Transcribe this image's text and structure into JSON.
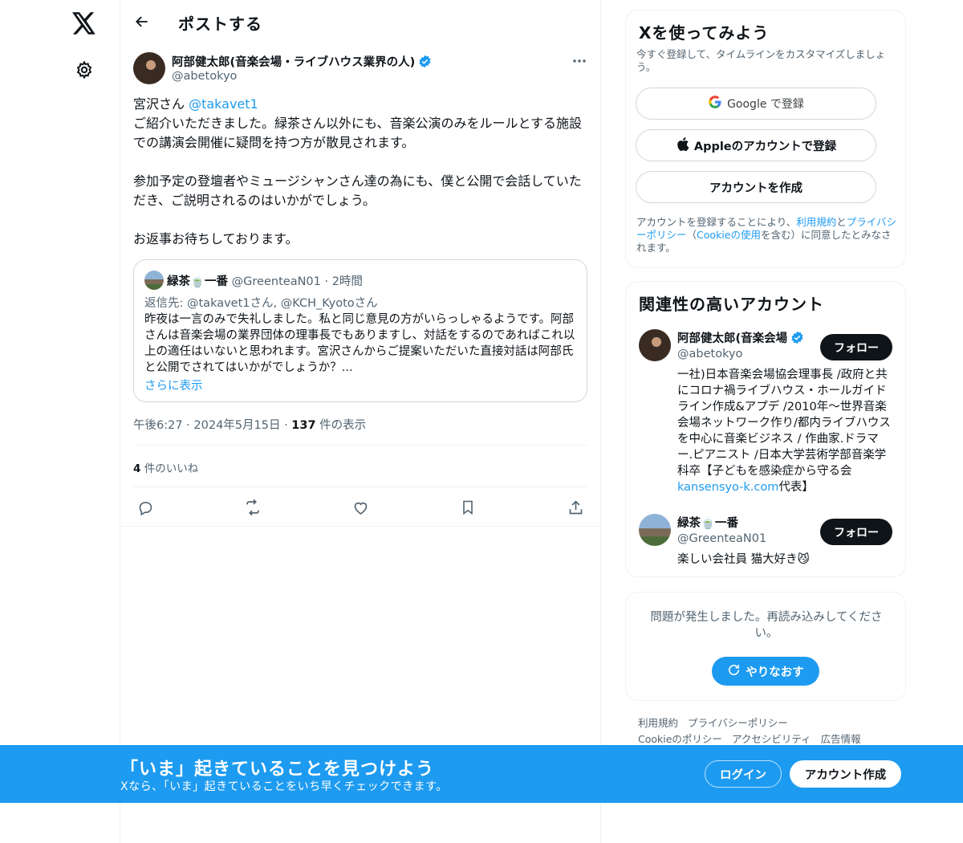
{
  "nav": {
    "logo": "X",
    "settings_icon": "gear-icon"
  },
  "header": {
    "back_icon": "arrow-left-icon",
    "title": "ポストする"
  },
  "tweet": {
    "author_name": "阿部健太郎(音楽会場・ライブハウス業界の人)",
    "author_handle": "@abetokyo",
    "greeting": "宮沢さん ",
    "mention": "@takavet1",
    "body": "\nご紹介いただきました。緑茶さん以外にも、音楽公演のみをルールとする施設での講演会開催に疑問を持つ方が散見されます。\n\n参加予定の登壇者やミュージシャンさん達の為にも、僕と公開で会話していただき、ご説明されるのはいかがでしょう。\n\nお返事お待ちしております。",
    "time": "午後6:27 · 2024年5月15日 · ",
    "views_count": "137",
    "views_label": " 件の表示",
    "likes_count": "4",
    "likes_label": " 件のいいね"
  },
  "quote": {
    "name": "緑茶🍵一番",
    "handle_time": " @GreenteaN01 · 2時間",
    "reply_to": "返信先: @takavet1さん, @KCH_Kyotoさん",
    "body": "昨夜は一言のみで失礼しました。私と同じ意見の方がいらっしゃるようです。阿部さんは音楽会場の業界団体の理事長でもありますし、対話をするのであればこれ以上の適任はいないと思われます。宮沢さんからご提案いただいた直接対話は阿部氏と公開でされてはいかがでしょうか？...",
    "show_more": "さらに表示"
  },
  "signup": {
    "title": "Xを使ってみよう",
    "subtitle": "今すぐ登録して、タイムラインをカスタマイズしましょう。",
    "google": "Google で登録",
    "apple": "Appleのアカウントで登録",
    "create": "アカウントを作成",
    "legal_1": "アカウントを登録することにより、",
    "legal_terms": "利用規約",
    "legal_2": "と",
    "legal_privacy": "プライバシーポリシー",
    "legal_3": "（",
    "legal_cookie": "Cookieの使用",
    "legal_4": "を含む）に同意したとみなされます。"
  },
  "accounts": {
    "title": "関連性の高いアカウント",
    "items": [
      {
        "name": "阿部健太郎(音楽会場",
        "handle": "@abetokyo",
        "bio_1": "一社)日本音楽会場協会理事長 /政府と共にコロナ禍ライブハウス・ホールガイドライン作成&アプデ /2010年〜世界音楽会場ネットワーク作り/都内ライブハウスを中心に音楽ビジネス / 作曲家.ドラマー.ピアニスト /日本大学芸術学部音楽学科卒【子どもを感染症から守る会",
        "bio_link": "kansensyo-k.com",
        "bio_2": "代表】",
        "follow": "フォロー"
      },
      {
        "name": "緑茶🍵一番",
        "handle": "@GreenteaN01",
        "bio": "楽しい会社員 猫大好き😼",
        "follow": "フォロー"
      }
    ]
  },
  "error": {
    "message": "問題が発生しました。再読み込みしてください。",
    "retry": "やりなおす"
  },
  "footer": {
    "links": [
      "利用規約",
      "プライバシーポリシー",
      "Cookieのポリシー",
      "アクセシビリティ",
      "広告情報"
    ]
  },
  "banner": {
    "title": "「いま」起きていることを見つけよう",
    "subtitle": "Xなら、「いま」起きていることをいち早くチェックできます。",
    "login": "ログイン",
    "create": "アカウント作成"
  },
  "colors": {
    "accent": "#1d9bf0",
    "text": "#0f1419",
    "muted": "#536471",
    "border": "#eff3f4"
  }
}
